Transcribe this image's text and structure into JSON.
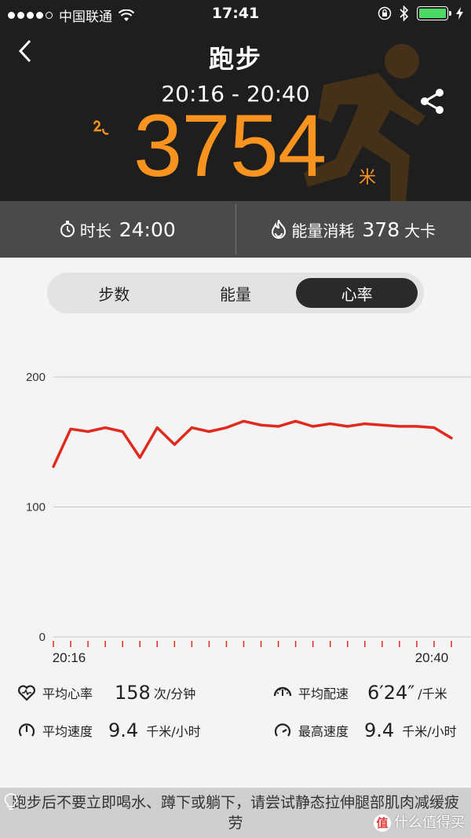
{
  "status_bar": {
    "carrier": "中国联通",
    "time": "17:41"
  },
  "header": {
    "title": "跑步",
    "time_range": "20:16 - 20:40",
    "distance": "3754",
    "distance_unit": "米"
  },
  "stats": {
    "duration_label": "时长",
    "duration_value": "24:00",
    "energy_label": "能量消耗",
    "energy_value": "378",
    "energy_unit": "大卡"
  },
  "tabs": [
    {
      "label": "步数",
      "active": false
    },
    {
      "label": "能量",
      "active": false
    },
    {
      "label": "心率",
      "active": true
    }
  ],
  "chart_data": {
    "type": "line",
    "x_start_label": "20:16",
    "x_end_label": "20:40",
    "y_ticks": [
      "0",
      "100",
      "200"
    ],
    "ylim": [
      0,
      200
    ],
    "grid": true,
    "line_color": "#e02a1e",
    "series": [
      {
        "values": [
          131,
          160,
          158,
          161,
          158,
          138,
          161,
          148,
          161,
          158,
          161,
          166,
          163,
          162,
          166,
          162,
          164,
          162,
          164,
          163,
          162,
          162,
          161,
          153
        ]
      }
    ]
  },
  "metrics": {
    "avg_hr_label": "平均心率",
    "avg_hr_value": "158",
    "avg_hr_unit": "次/分钟",
    "avg_pace_label": "平均配速",
    "avg_pace_value": "6′24″",
    "avg_pace_unit": "/千米",
    "avg_speed_label": "平均速度",
    "avg_speed_value": "9.4",
    "avg_speed_unit": "千米/小时",
    "max_speed_label": "最高速度",
    "max_speed_value": "9.4",
    "max_speed_unit": "千米/小时"
  },
  "tip": {
    "text": "跑步后不要立即喝水、蹲下或躺下，请尝试静态拉伸腿部肌肉减缓疲劳"
  },
  "watermark": {
    "badge": "值",
    "text": "什么值得买"
  },
  "colors": {
    "accent": "#f7931e",
    "header_bg": "#1e1e1e",
    "stats_bg": "#4a4a4a",
    "chart_line": "#e02a1e"
  }
}
